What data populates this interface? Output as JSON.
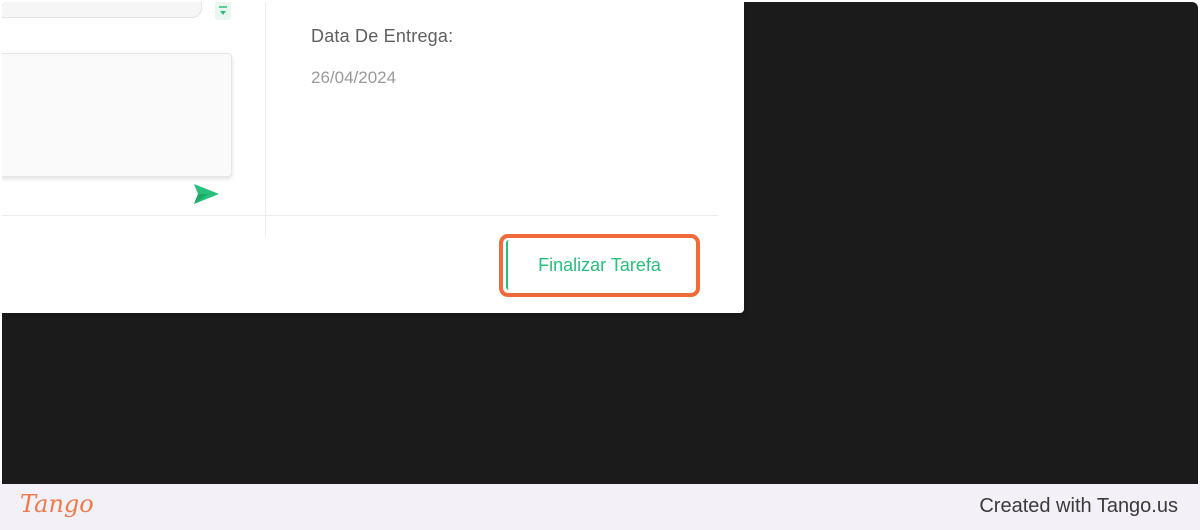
{
  "modal": {
    "date_label": "Data De Entrega:",
    "date_value": "26/04/2024",
    "finish_button_label": "Finalizar Tarefa"
  },
  "footer": {
    "logo_text": "Tango",
    "created_with": "Created with Tango.us"
  },
  "colors": {
    "accent_green": "#27c07a",
    "highlight_orange": "#f06b3a",
    "backdrop": "#1b1b1b",
    "footer_bg": "#f3f0f7"
  },
  "icons": {
    "send": "send-icon",
    "scroll_down": "chevron-down-icon"
  }
}
